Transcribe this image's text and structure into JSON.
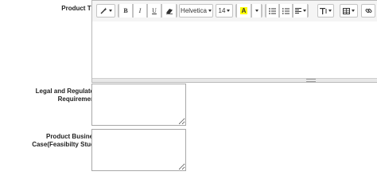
{
  "form": {
    "product_title_label": "Product Title",
    "legal_label": "Legal and Regulatory Requirements",
    "business_case_label": "Product Business Case(Feasibilty Study)",
    "legal_value": "",
    "business_case_value": ""
  },
  "toolbar": {
    "style_icon": "magic-wand-icon",
    "bold": "B",
    "italic": "I",
    "underline": "U",
    "eraser_icon": "eraser-icon",
    "font_family": "Helvetica",
    "font_size": "14",
    "color_letter": "A",
    "color_highlight": "#ffff00",
    "unordered_list_icon": "unordered-list-icon",
    "ordered_list_icon": "ordered-list-icon",
    "align_icon": "align-left-icon",
    "line_height_icon": "line-height-icon",
    "table_icon": "table-icon",
    "link_icon": "link-icon"
  }
}
